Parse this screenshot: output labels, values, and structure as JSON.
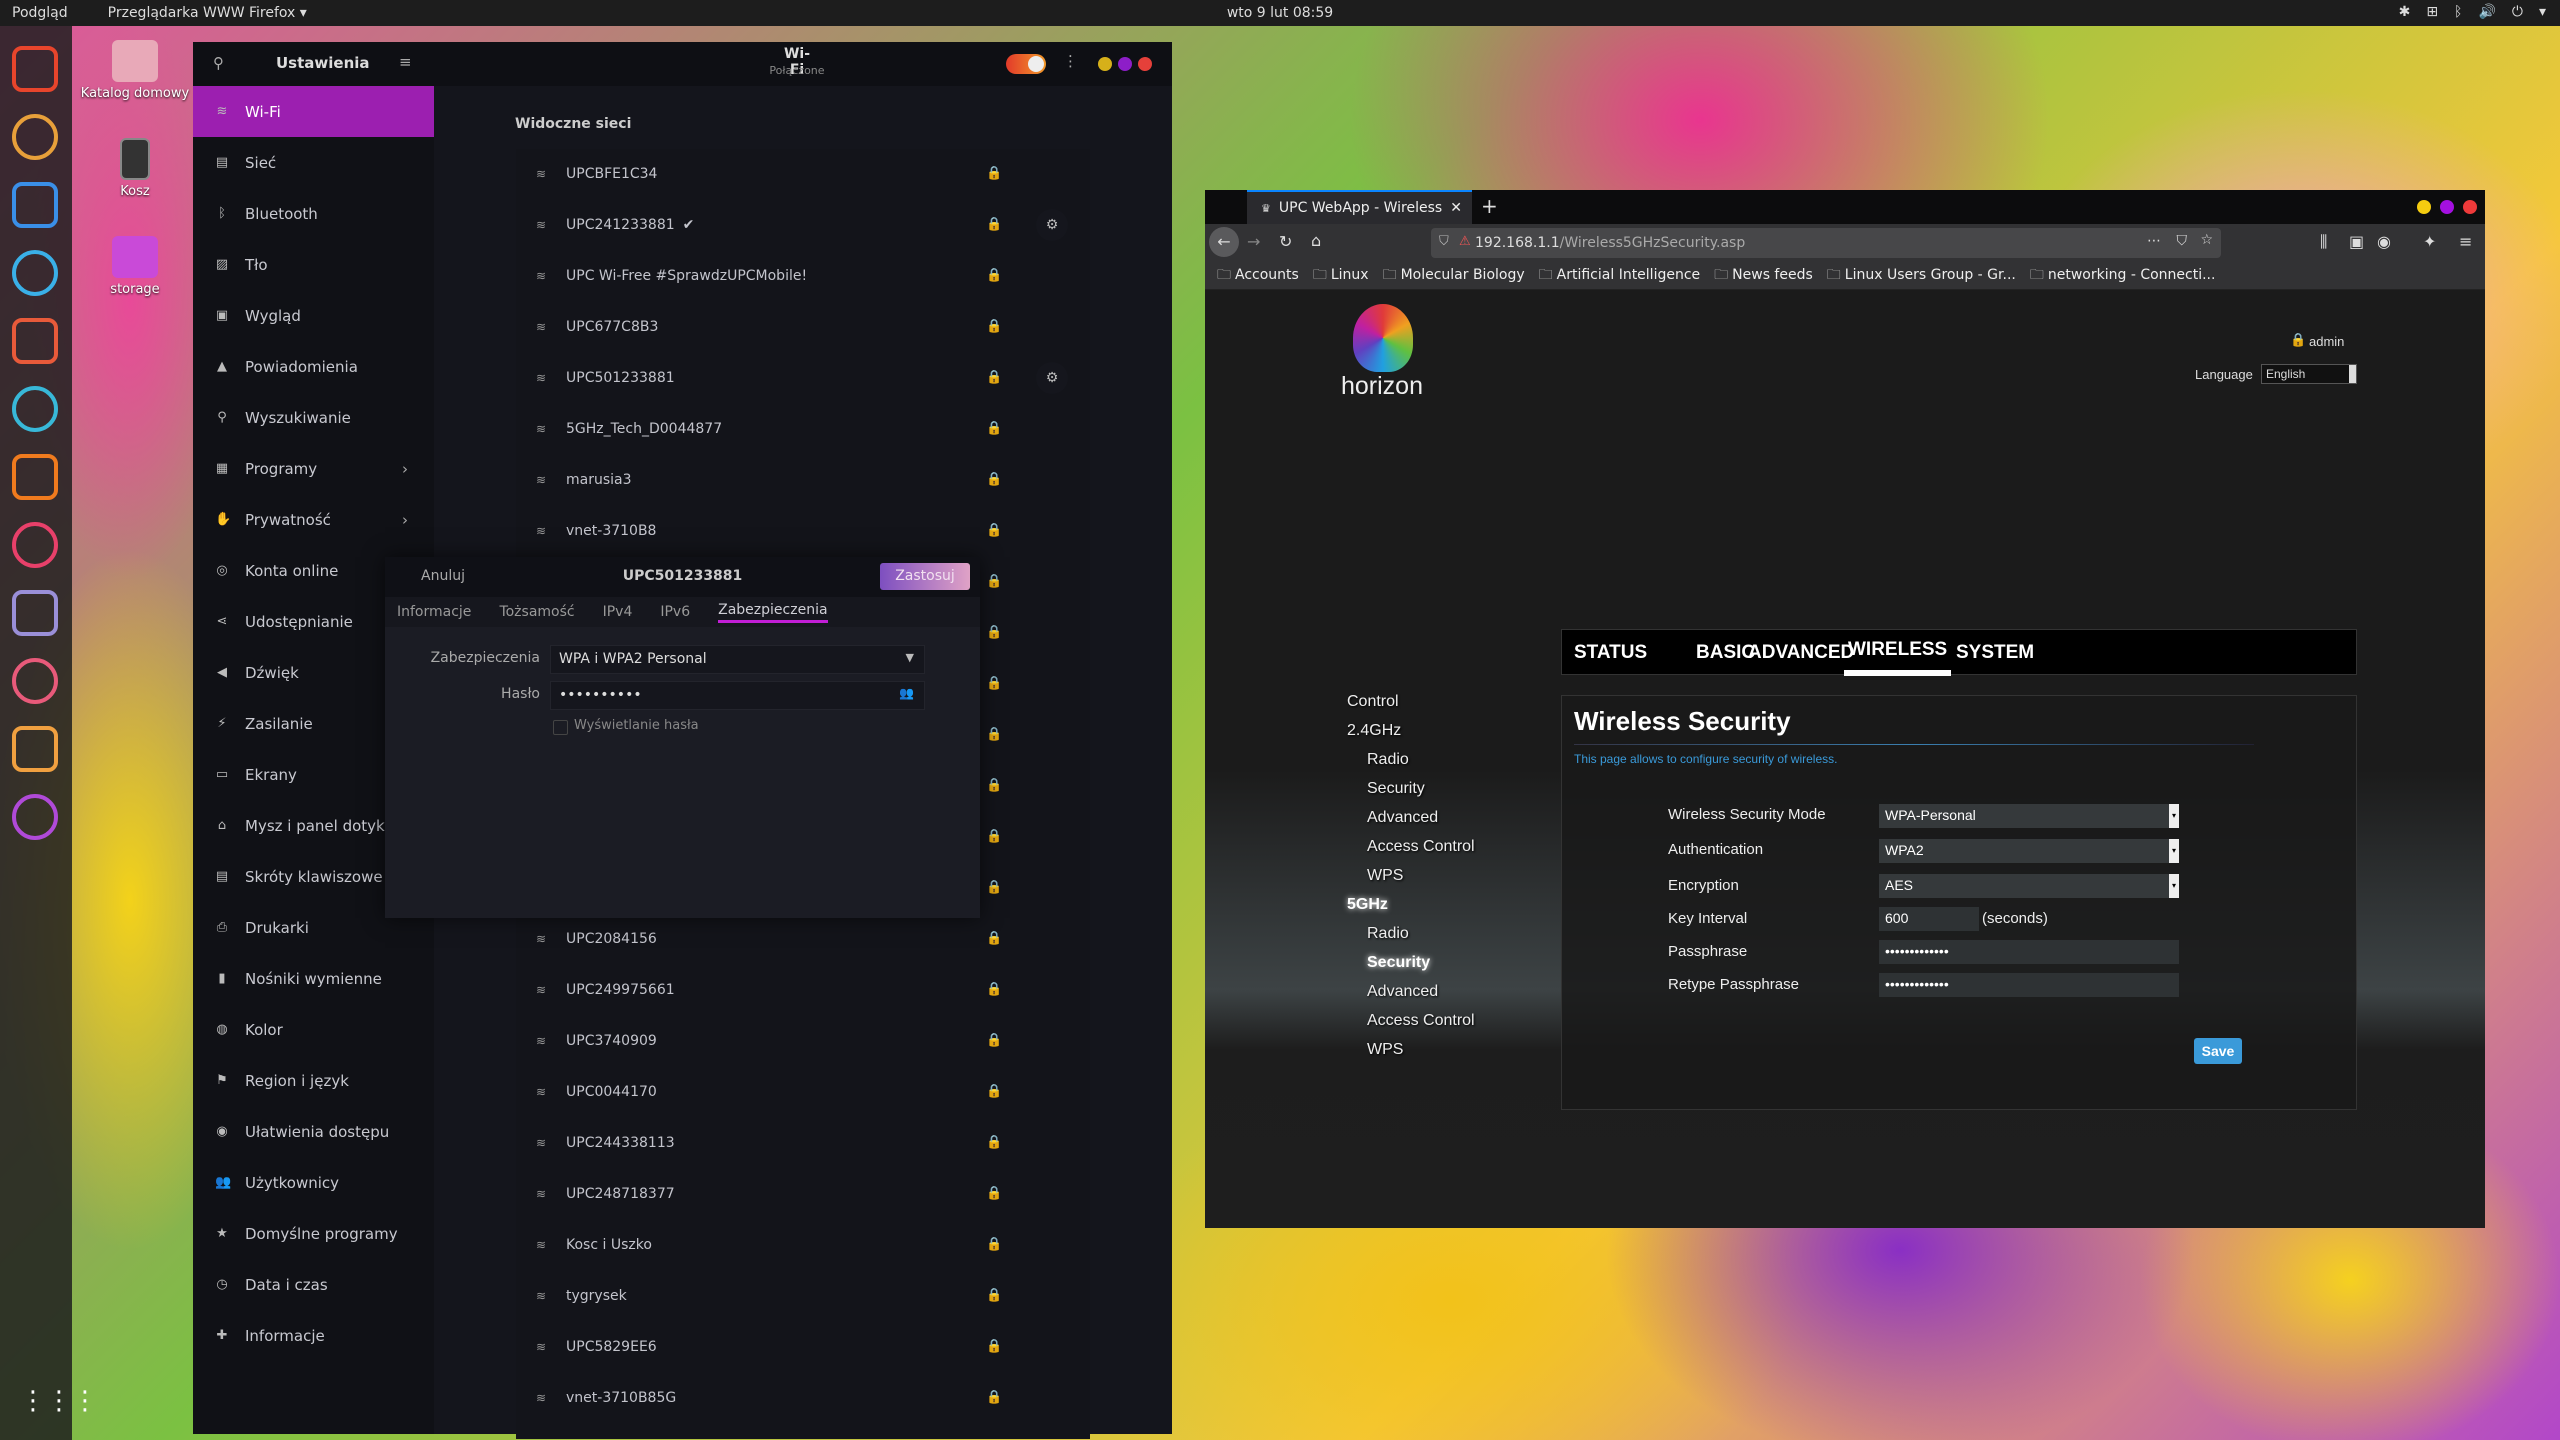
{
  "topbar": {
    "activities": "Podgląd",
    "app_menu": "Przeglądarka WWW Firefox ▾",
    "clock": "wto 9 lut  08:59",
    "tray": [
      "✱",
      "⊞",
      "ᛒ",
      "🔊",
      "⏻",
      "▾"
    ]
  },
  "dock": [
    {
      "icon": "firefox-icon",
      "color": "#e8452c"
    },
    {
      "icon": "chrome-icon",
      "color": "#e8a03a"
    },
    {
      "icon": "skype-icon",
      "color": "#3a8fe8"
    },
    {
      "icon": "remote-desktop-icon",
      "color": "#3ab0e8"
    },
    {
      "icon": "files-icon",
      "color": "#e85a3a"
    },
    {
      "icon": "terminal-icon",
      "color": "#38b8d8"
    },
    {
      "icon": "sublime-icon",
      "color": "#f07b1e"
    },
    {
      "icon": "text-editor-icon",
      "color": "#e8406a"
    },
    {
      "icon": "r-studio-icon",
      "color": "#9a8fd8"
    },
    {
      "icon": "screenshot-icon",
      "color": "#e85a7a"
    },
    {
      "icon": "settings-icon",
      "color": "#f0a040"
    },
    {
      "icon": "camera-icon",
      "color": "#b04ad8"
    }
  ],
  "desktop": [
    {
      "label": "Katalog domowy"
    },
    {
      "label": "Kosz"
    },
    {
      "label": "storage"
    }
  ],
  "settings": {
    "title": "Ustawienia",
    "panel_title": "Wi-Fi",
    "panel_subtitle": "Połączone",
    "sidebar": [
      {
        "label": "Wi-Fi",
        "icon": "wifi-icon",
        "g": "≋"
      },
      {
        "label": "Sieć",
        "icon": "network-icon",
        "g": "▤"
      },
      {
        "label": "Bluetooth",
        "icon": "bluetooth-icon",
        "g": "ᛒ"
      },
      {
        "label": "Tło",
        "icon": "background-icon",
        "g": "▨"
      },
      {
        "label": "Wygląd",
        "icon": "appearance-icon",
        "g": "▣"
      },
      {
        "label": "Powiadomienia",
        "icon": "bell-icon",
        "g": "▲"
      },
      {
        "label": "Wyszukiwanie",
        "icon": "search-icon",
        "g": "⚲"
      },
      {
        "label": "Programy",
        "icon": "apps-icon",
        "g": "▦",
        "chevron": true
      },
      {
        "label": "Prywatność",
        "icon": "hand-icon",
        "g": "✋",
        "chevron": true
      },
      {
        "label": "Konta online",
        "icon": "online-accounts-icon",
        "g": "◎"
      },
      {
        "label": "Udostępnianie",
        "icon": "share-icon",
        "g": "⋖"
      },
      {
        "label": "Dźwięk",
        "icon": "speaker-icon",
        "g": "◀"
      },
      {
        "label": "Zasilanie",
        "icon": "power-icon",
        "g": "⚡"
      },
      {
        "label": "Ekrany",
        "icon": "display-icon",
        "g": "▭"
      },
      {
        "label": "Mysz i panel dotykowy",
        "icon": "mouse-icon",
        "g": "⌂"
      },
      {
        "label": "Skróty klawiszowe",
        "icon": "keyboard-icon",
        "g": "▤"
      },
      {
        "label": "Drukarki",
        "icon": "printer-icon",
        "g": "⎙"
      },
      {
        "label": "Nośniki wymienne",
        "icon": "usb-icon",
        "g": "▮"
      },
      {
        "label": "Kolor",
        "icon": "color-icon",
        "g": "◍"
      },
      {
        "label": "Region i język",
        "icon": "flag-icon",
        "g": "⚑"
      },
      {
        "label": "Ułatwienia dostępu",
        "icon": "accessibility-icon",
        "g": "◉"
      },
      {
        "label": "Użytkownicy",
        "icon": "users-icon",
        "g": "👥"
      },
      {
        "label": "Domyślne programy",
        "icon": "star-icon",
        "g": "★"
      },
      {
        "label": "Data i czas",
        "icon": "clock-icon",
        "g": "◷"
      },
      {
        "label": "Informacje",
        "icon": "info-icon",
        "g": "✚"
      }
    ],
    "networks_heading": "Widoczne sieci",
    "networks": [
      {
        "name": "UPCBFE1C34"
      },
      {
        "name": "UPC241233881",
        "connected": true,
        "gear": true
      },
      {
        "name": "UPC Wi-Free #SprawdzUPCMobile!"
      },
      {
        "name": "UPC677C8B3"
      },
      {
        "name": "UPC501233881",
        "gear": true
      },
      {
        "name": "5GHz_Tech_D0044877"
      },
      {
        "name": "marusia3"
      },
      {
        "name": "vnet-3710B8"
      },
      {
        "name": ""
      },
      {
        "name": ""
      },
      {
        "name": ""
      },
      {
        "name": ""
      },
      {
        "name": ""
      },
      {
        "name": ""
      },
      {
        "name": ""
      },
      {
        "name": "UPC2084156"
      },
      {
        "name": "UPC249975661"
      },
      {
        "name": "UPC3740909"
      },
      {
        "name": "UPC0044170"
      },
      {
        "name": "UPC244338113"
      },
      {
        "name": "UPC248718377"
      },
      {
        "name": "Kosc i Uszko"
      },
      {
        "name": "tygrysek"
      },
      {
        "name": "UPC5829EE6"
      },
      {
        "name": "vnet-3710B85G"
      }
    ],
    "dialog": {
      "cancel": "Anuluj",
      "title": "UPC501233881",
      "apply": "Zastosuj",
      "tabs": [
        "Informacje",
        "Tożsamość",
        "IPv4",
        "IPv6",
        "Zabezpieczenia"
      ],
      "active_tab": "Zabezpieczenia",
      "security_label": "Zabezpieczenia",
      "security_value": "WPA i WPA2 Personal",
      "password_label": "Hasło",
      "password_value": "••••••••••",
      "show_password_label": "Wyświetlanie hasła",
      "show_password_checked": false
    }
  },
  "firefox": {
    "tab_title": "UPC WebApp - Wireless",
    "url_host": "192.168.1.1",
    "url_path": "/Wireless5GHzSecurity.asp",
    "bookmarks": [
      "Accounts",
      "Linux",
      "Molecular Biology",
      "Artificial Intelligence",
      "News feeds",
      "Linux Users Group - Gr...",
      "networking - Connecti..."
    ]
  },
  "router": {
    "logo_text": "horizon",
    "user": "admin",
    "language_label": "Language",
    "language_value": "English",
    "nav": [
      "STATUS",
      "BASIC",
      "ADVANCED",
      "WIRELESS",
      "SYSTEM"
    ],
    "active_nav": "WIRELESS",
    "menu": [
      {
        "label": "Control",
        "level": 0
      },
      {
        "label": "2.4GHz",
        "level": 0
      },
      {
        "label": "Radio",
        "level": 1
      },
      {
        "label": "Security",
        "level": 1
      },
      {
        "label": "Advanced",
        "level": 1
      },
      {
        "label": "Access Control",
        "level": 1
      },
      {
        "label": "WPS",
        "level": 1
      },
      {
        "label": "5GHz",
        "level": 0,
        "active": true
      },
      {
        "label": "Radio",
        "level": 1
      },
      {
        "label": "Security",
        "level": 1,
        "active": true
      },
      {
        "label": "Advanced",
        "level": 1
      },
      {
        "label": "Access Control",
        "level": 1
      },
      {
        "label": "WPS",
        "level": 1
      }
    ],
    "heading": "Wireless Security",
    "description": "This page allows to configure security of wireless.",
    "fields": {
      "mode_label": "Wireless Security Mode",
      "mode_value": "WPA-Personal",
      "auth_label": "Authentication",
      "auth_value": "WPA2",
      "enc_label": "Encryption",
      "enc_value": "AES",
      "key_label": "Key Interval",
      "key_value": "600",
      "key_unit": "(seconds)",
      "pass_label": "Passphrase",
      "pass_value": "•••••••••••••",
      "repass_label": "Retype Passphrase",
      "repass_value": "•••••••••••••"
    },
    "save": "Save",
    "accent": "#3a9ad9"
  }
}
